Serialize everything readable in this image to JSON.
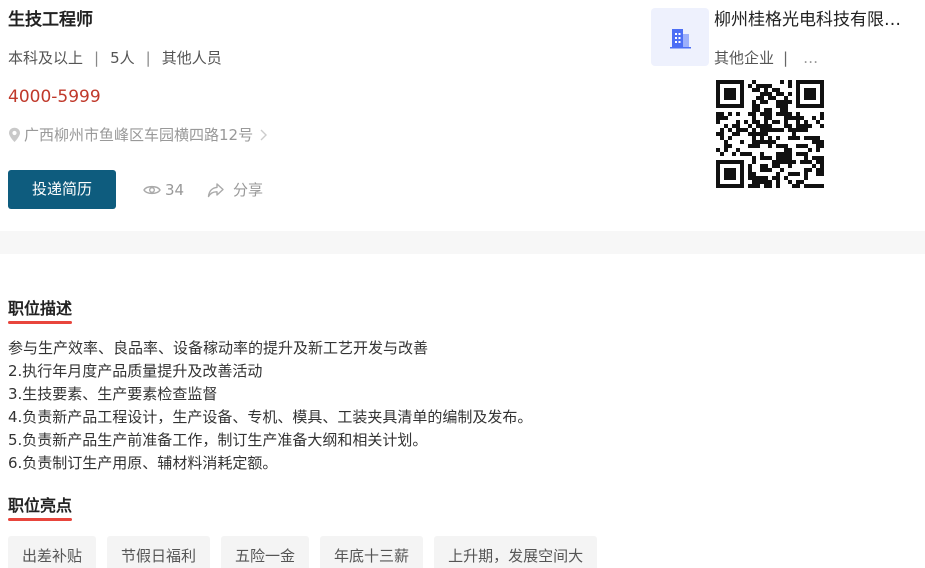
{
  "job": {
    "title": "生技工程师",
    "education": "本科及以上",
    "headcount": "5人",
    "category": "其他人员",
    "salary": "4000-5999",
    "address": "广西柳州市鱼峰区车园横四路12号",
    "apply_label": "投递简历",
    "views": "34",
    "share_label": "分享"
  },
  "company": {
    "name": "柳州桂格光电科技有限公司",
    "type": "其他企业",
    "more": "…"
  },
  "description": {
    "title": "职位描述",
    "lines": [
      "参与生产效率、良品率、设备稼动率的提升及新工艺开发与改善",
      "2.执行年月度产品质量提升及改善活动",
      "3.生技要素、生产要素检查监督",
      "4.负责新产品工程设计，生产设备、专机、模具、工装夹具清单的编制及发布。",
      "5.负责新产品生产前准备工作，制订生产准备大纲和相关计划。",
      "6.负责制订生产用原、辅材料消耗定额。"
    ]
  },
  "highlights": {
    "title": "职位亮点",
    "tags": [
      "出差补贴",
      "节假日福利",
      "五险一金",
      "年底十三薪",
      "上升期，发展空间大"
    ]
  },
  "colors": {
    "accent": "#0e5c7e",
    "salary": "#c0392b",
    "underline": "#e8453c",
    "logo_bg": "#eef1fd",
    "logo_fg": "#4c6ef5"
  },
  "icons": {
    "address": "location-pin-icon",
    "address_more": "chevron-right-icon",
    "views": "eye-icon",
    "share": "share-icon",
    "company_logo": "building-icon",
    "qr": "qr-code-icon"
  }
}
